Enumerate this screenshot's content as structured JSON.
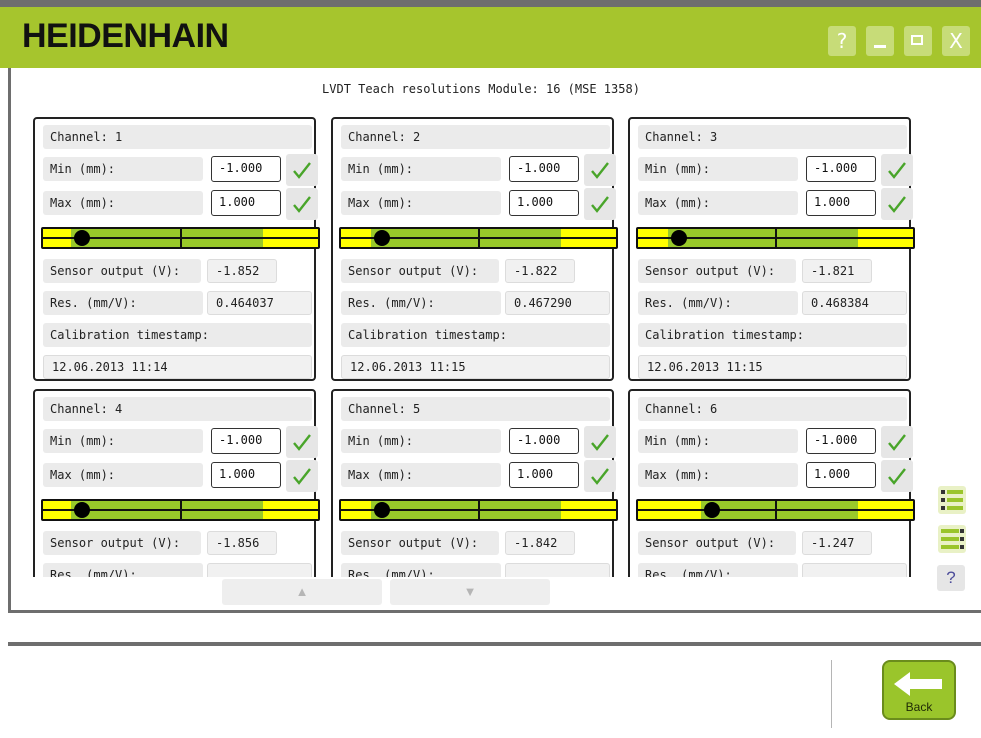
{
  "app": {
    "logo": "HEIDENHAIN",
    "window_buttons": [
      {
        "name": "help-icon",
        "label": "?"
      },
      {
        "name": "minimize-icon",
        "label": ""
      },
      {
        "name": "maximize-icon",
        "label": ""
      },
      {
        "name": "close-icon",
        "label": "X"
      }
    ]
  },
  "panel": {
    "title": "LVDT Teach resolutions Module: 16 (MSE 1358)"
  },
  "labels": {
    "min": "Min (mm):",
    "max": "Max (mm):",
    "sensor": "Sensor output (V):",
    "res": "Res. (mm/V):",
    "calib": "Calibration timestamp:"
  },
  "channels": [
    {
      "title": "Channel: 1",
      "min": "-1.000",
      "max": "1.000",
      "sensor": "-1.852",
      "res": "0.464037",
      "timestamp": "12.06.2013 11:14",
      "knob_fraction": 0.14
    },
    {
      "title": "Channel: 2",
      "min": "-1.000",
      "max": "1.000",
      "sensor": "-1.822",
      "res": "0.467290",
      "timestamp": "12.06.2013 11:15",
      "knob_fraction": 0.15
    },
    {
      "title": "Channel: 3",
      "min": "-1.000",
      "max": "1.000",
      "sensor": "-1.821",
      "res": "0.468384",
      "timestamp": "12.06.2013 11:15",
      "knob_fraction": 0.15
    },
    {
      "title": "Channel: 4",
      "min": "-1.000",
      "max": "1.000",
      "sensor": "-1.856",
      "res": "",
      "timestamp": "",
      "knob_fraction": 0.14
    },
    {
      "title": "Channel: 5",
      "min": "-1.000",
      "max": "1.000",
      "sensor": "-1.842",
      "res": "",
      "timestamp": "",
      "knob_fraction": 0.15
    },
    {
      "title": "Channel: 6",
      "min": "-1.000",
      "max": "1.000",
      "sensor": "-1.247",
      "res": "",
      "timestamp": "",
      "knob_fraction": 0.27
    }
  ],
  "nav": {
    "up": "▲",
    "down": "▼"
  },
  "side": {
    "help": "?"
  },
  "footer": {
    "back_label": "Back"
  },
  "colors": {
    "accent": "#a6c52d",
    "bar_yellow": "#ffff00",
    "bar_green": "#99c92a",
    "check_green": "#49a52a"
  }
}
